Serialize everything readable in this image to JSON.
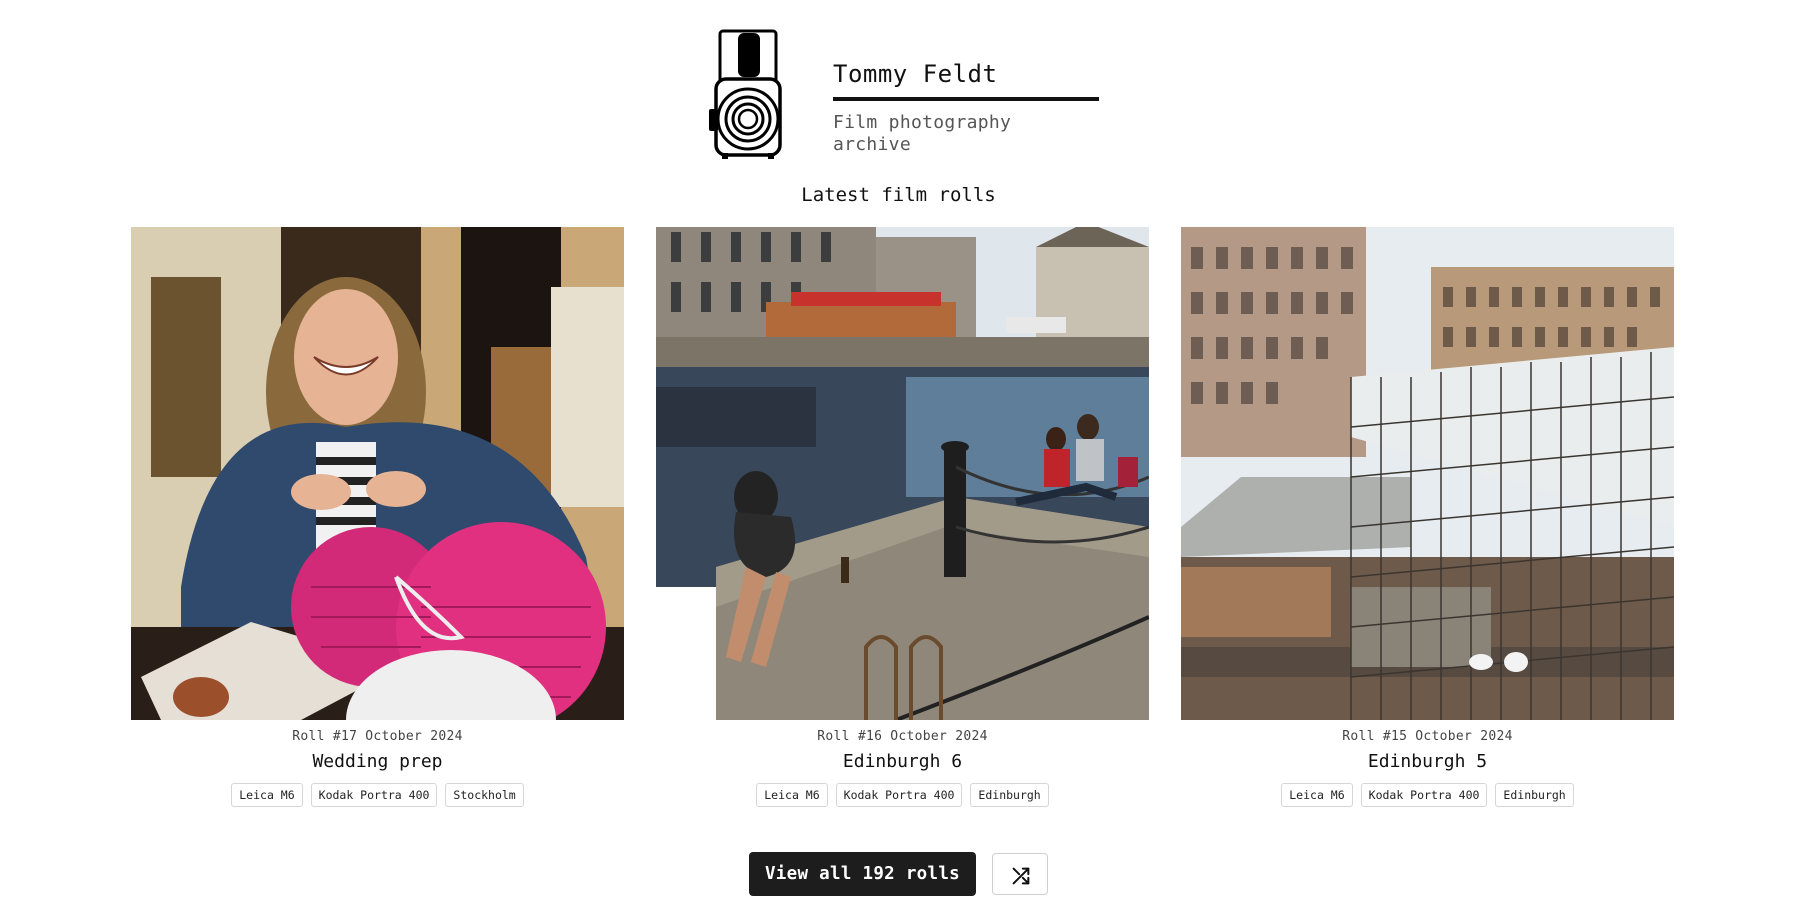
{
  "site": {
    "name": "Tommy Feldt",
    "tagline": "Film photography archive",
    "logo_icon": "medium-format-camera-icon"
  },
  "section": {
    "title": "Latest film rolls"
  },
  "rolls": [
    {
      "roll_number": "Roll #17",
      "date": "October 2024",
      "title": "Wedding prep",
      "tags": [
        "Leica M6",
        "Kodak Portra 400",
        "Stockholm"
      ],
      "photo_alt": "Woman laughing with pink paper decorations"
    },
    {
      "roll_number": "Roll #16",
      "date": "October 2024",
      "title": "Edinburgh 6",
      "tags": [
        "Leica M6",
        "Kodak Portra 400",
        "Edinburgh"
      ],
      "photo_alt": "Canal quayside with people sitting by the water"
    },
    {
      "roll_number": "Roll #15",
      "date": "October 2024",
      "title": "Edinburgh 5",
      "tags": [
        "Leica M6",
        "Kodak Portra 400",
        "Edinburgh"
      ],
      "photo_alt": "Scaffolding on a station roof in front of old buildings"
    }
  ],
  "actions": {
    "view_all_label": "View all 192 rolls",
    "shuffle_icon": "shuffle-icon"
  },
  "colors": {
    "primary_button": "#1d1d1d",
    "text": "#111111",
    "muted": "#555555",
    "tag_border": "#d6d6d6"
  }
}
